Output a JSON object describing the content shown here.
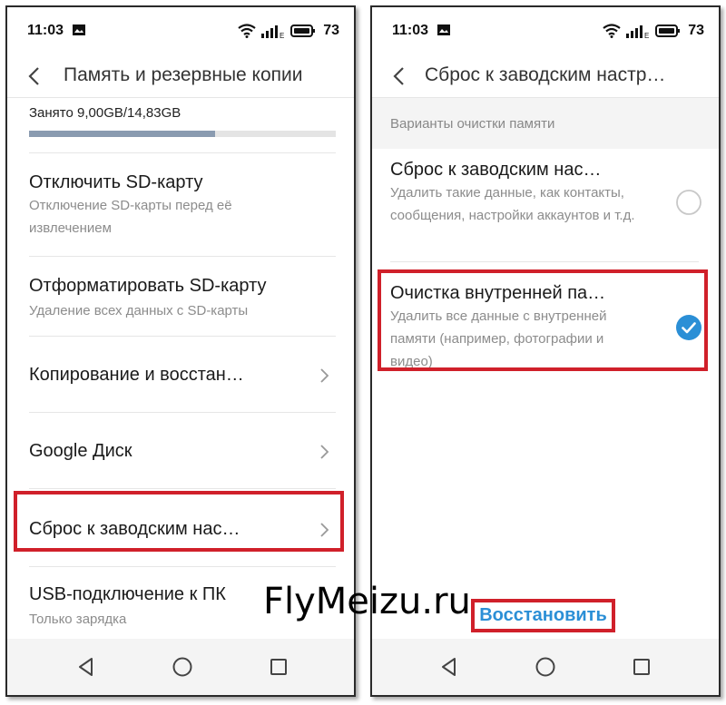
{
  "status_bar": {
    "time": "11:03",
    "battery_level": "73",
    "network_label": "E"
  },
  "left_screen": {
    "title": "Память и резервные копии",
    "storage_label": "Занято 9,00GB/14,83GB",
    "storage_used_fraction": 0.607,
    "items": [
      {
        "title": "Отключить SD-карту",
        "subtitle": "Отключение SD-карты перед её извлечением"
      },
      {
        "title": "Отформатировать SD-карту",
        "subtitle": "Удаление всех данных с SD-карты"
      },
      {
        "title": "Копирование и восстан…"
      },
      {
        "title": "Google Диск"
      },
      {
        "title": "Сброс к заводским нас…"
      },
      {
        "title": "USB-подключение к ПК",
        "subtitle": "Только зарядка"
      }
    ]
  },
  "right_screen": {
    "title": "Сброс к заводским настр…",
    "section_header": "Варианты очистки памяти",
    "options": [
      {
        "title": "Сброс к заводским нас…",
        "subtitle": "Удалить такие данные, как контакты, сообщения, настройки аккаунтов и т.д.",
        "selected": false
      },
      {
        "title": "Очистка внутренней па…",
        "subtitle": "Удалить все данные с внутренней памяти (например, фотографии и видео)",
        "selected": true
      }
    ],
    "action_button": "Восстановить"
  },
  "watermark": "FlyMeizu.ru",
  "colors": {
    "accent": "#2b8fd6",
    "highlight": "#d0202a",
    "storage_fill": "#8a9bb0"
  }
}
